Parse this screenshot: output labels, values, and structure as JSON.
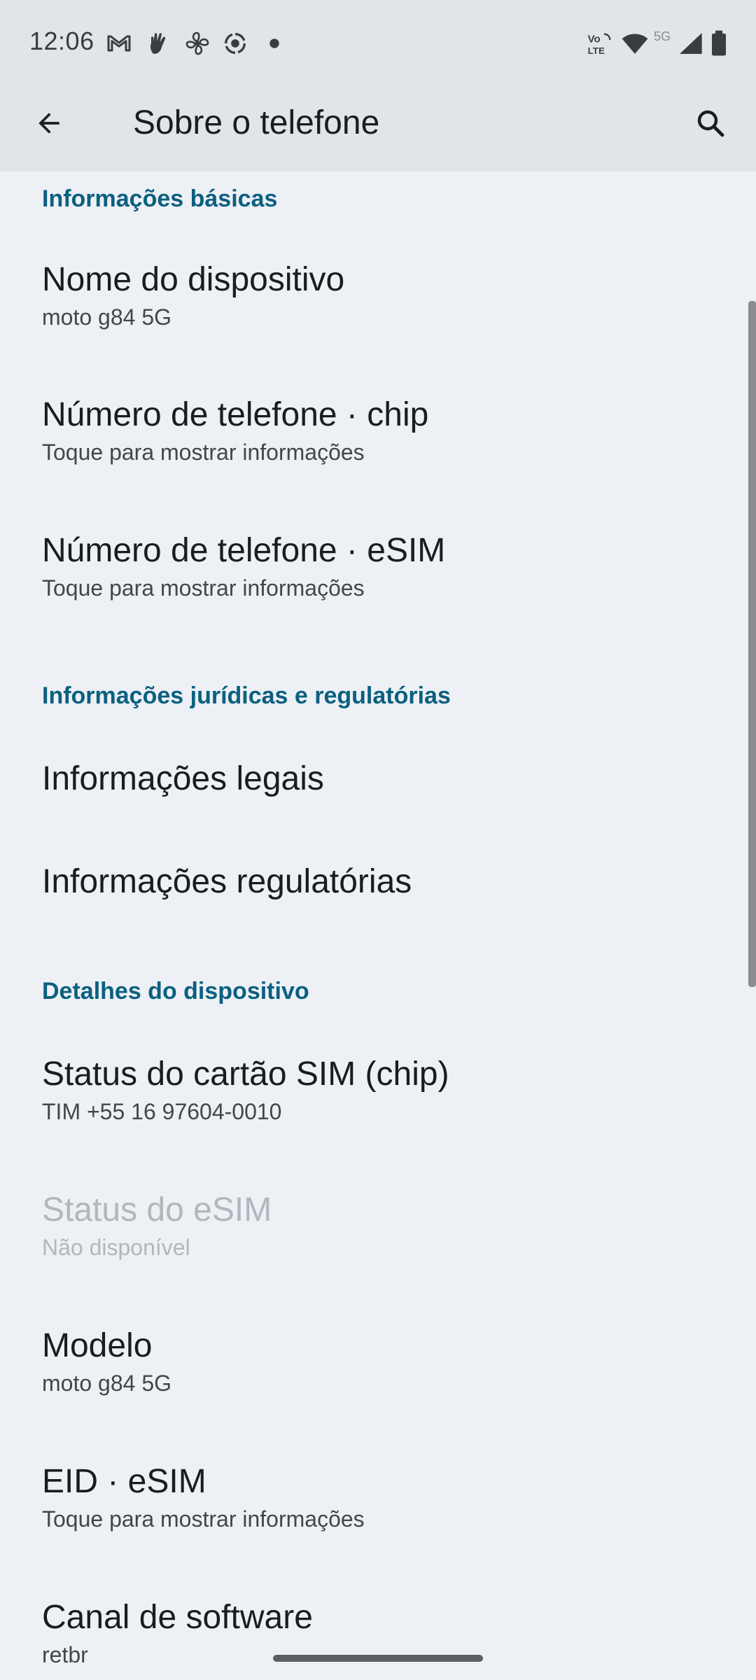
{
  "status_bar": {
    "time": "12:06",
    "icons_left": [
      "gmail-icon",
      "hand-icon",
      "fan-icon",
      "focus-icon",
      "dot-icon"
    ],
    "icons_right": [
      "volte-icon",
      "wifi-icon",
      "5g-icon",
      "signal-icon",
      "battery-icon"
    ],
    "volte_top": "Vo",
    "volte_bottom": "LTE",
    "network": "5G"
  },
  "app_bar": {
    "title": "Sobre o telefone",
    "back_icon": "arrow-back-icon",
    "search_icon": "search-icon"
  },
  "colors": {
    "background": "#edf0f5",
    "app_bar": "#e1e4e9",
    "section_header": "#0b6080",
    "text_primary": "#1b1c1f",
    "text_secondary": "#44464a",
    "text_disabled": "#b3b6bc"
  },
  "sections": {
    "basic": {
      "header": "Informações básicas",
      "items": [
        {
          "title": "Nome do dispositivo",
          "summary": "moto g84 5G"
        },
        {
          "title": "Número de telefone · chip",
          "summary": "Toque para mostrar informações"
        },
        {
          "title": "Número de telefone · eSIM",
          "summary": "Toque para mostrar informações"
        }
      ]
    },
    "legal": {
      "header": "Informações jurídicas e regulatórias",
      "items": [
        {
          "title": "Informações legais"
        },
        {
          "title": "Informações regulatórias"
        }
      ]
    },
    "device": {
      "header": "Detalhes do dispositivo",
      "items": [
        {
          "title": "Status do cartão SIM (chip)",
          "summary": "TIM +55 16 97604-0010"
        },
        {
          "title": "Status do eSIM",
          "summary": "Não disponível",
          "enabled": false
        },
        {
          "title": "Modelo",
          "summary": "moto g84 5G"
        },
        {
          "title": "EID · eSIM",
          "summary": "Toque para mostrar informações"
        },
        {
          "title": "Canal de software",
          "summary": "retbr"
        }
      ]
    }
  }
}
